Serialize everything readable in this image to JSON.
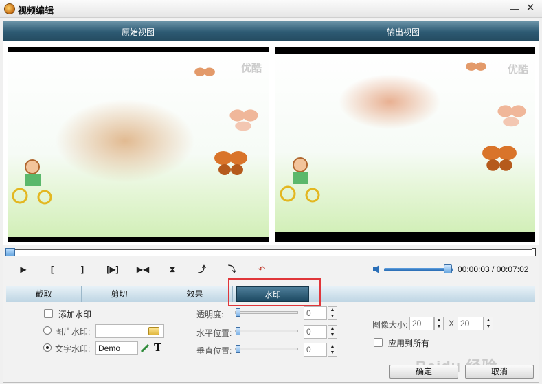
{
  "window": {
    "title": "视频编辑",
    "minimize_glyph": "—",
    "close_glyph": "✕"
  },
  "views": {
    "original_label": "原始视图",
    "output_label": "输出视图",
    "video_watermark": "优酷"
  },
  "controls": {
    "play_glyph": "▶",
    "mark_in_glyph": "[",
    "mark_out_glyph": "]",
    "play_segment_glyph": "[▶]",
    "step_glyph": "▶◀",
    "flip_v_glyph": "⧗",
    "rotate_left_glyph": "⤴",
    "rotate_right_glyph": "⤵",
    "undo_glyph": "↶",
    "time": "00:00:03 / 00:07:02",
    "volume_fraction": 0.87,
    "timeline_fraction": 0.0
  },
  "tabs": [
    {
      "label": "截取",
      "active": false
    },
    {
      "label": "剪切",
      "active": false
    },
    {
      "label": "效果",
      "active": false
    },
    {
      "label": "水印",
      "active": true
    }
  ],
  "watermark": {
    "add_label": "添加水印",
    "image_label": "图片水印:",
    "text_label": "文字水印:",
    "text_value": "Demo",
    "font_icon_text": "T",
    "opacity_label": "透明度:",
    "h_pos_label": "水平位置:",
    "v_pos_label": "垂直位置:",
    "opacity_value": "0",
    "h_pos_value": "0",
    "v_pos_value": "0",
    "image_size_label": "图像大小:",
    "width_value": "20",
    "x_label": "X",
    "height_value": "20",
    "apply_all_label": "应用到所有"
  },
  "buttons": {
    "ok": "确定",
    "cancel": "取消"
  },
  "overlay_text": "Baidu 经验",
  "colors": {
    "header": "#2d5a73",
    "tab_active": "#1d4a63",
    "highlight": "#e0363a"
  },
  "icons": [
    "app-icon",
    "volume-icon",
    "folder-icon",
    "pen-icon",
    "font-icon"
  ]
}
